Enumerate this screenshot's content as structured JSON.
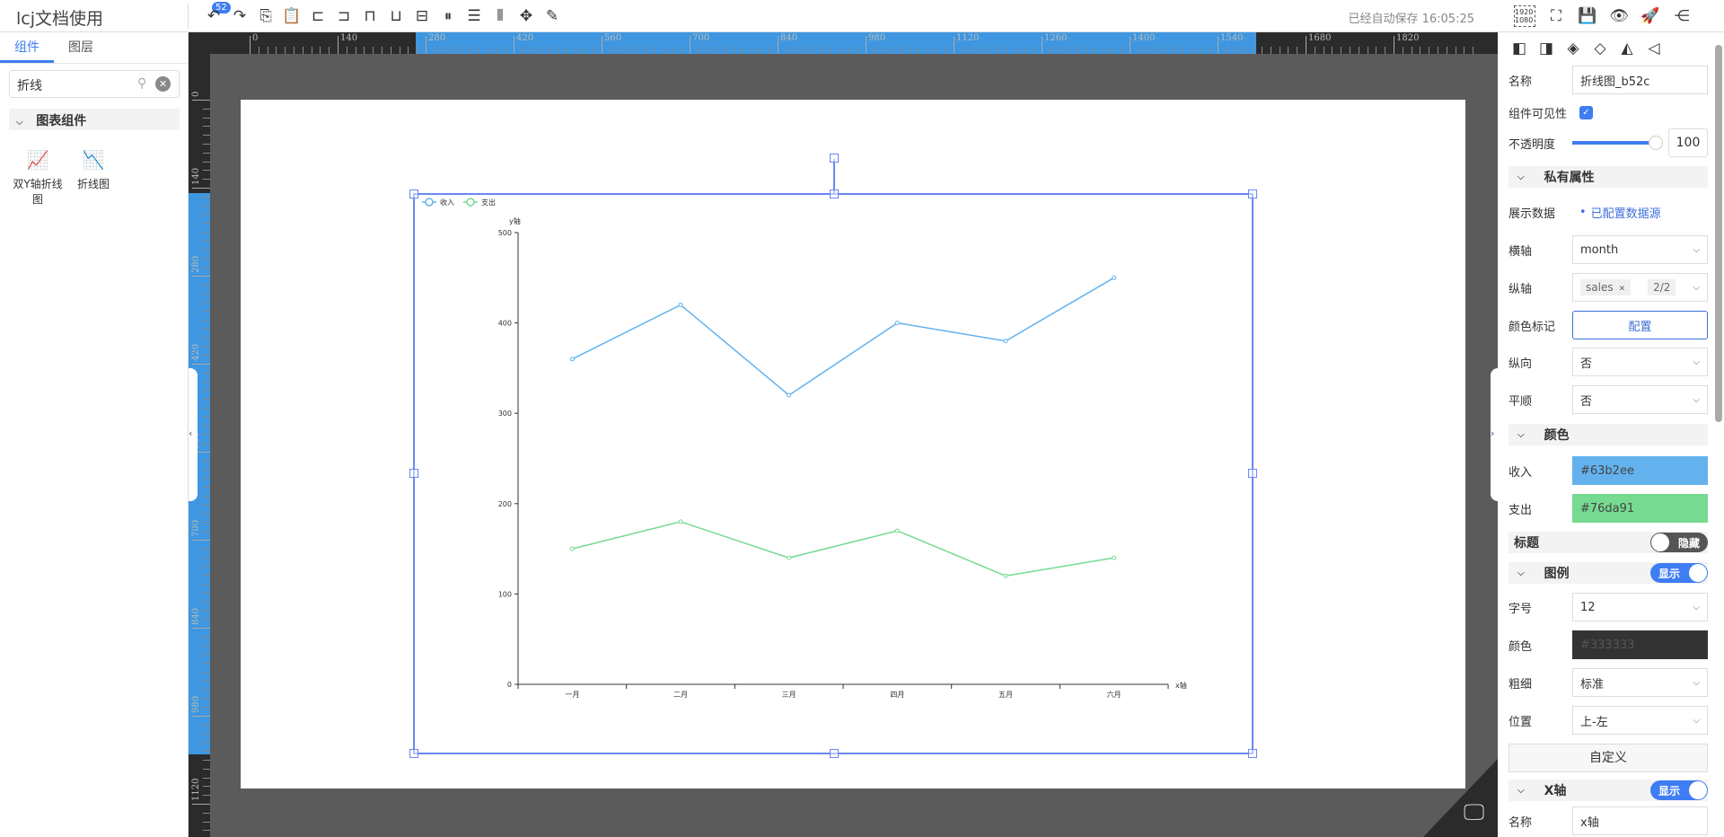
{
  "header": {
    "title": "lcj文档使用",
    "undo_count": "52",
    "autosave": "已经自动保存 16:05:25",
    "toolbar": [
      "undo-icon",
      "redo-icon",
      "copy-icon",
      "paste-icon",
      "align-left-icon",
      "align-right-icon",
      "align-top-icon",
      "align-bottom-icon",
      "align-vcenter-icon",
      "align-hcenter-icon",
      "distribute-v-icon",
      "distribute-h-icon",
      "move-icon",
      "edit-icon"
    ],
    "right_tools": [
      "resolution-1920-1080-icon",
      "fit-screen-icon",
      "save-icon",
      "preview-icon",
      "publish-icon",
      "share-icon"
    ],
    "resolution_label": "1920 1080"
  },
  "left": {
    "tabs": [
      "组件",
      "图层"
    ],
    "search_value": "折线",
    "category": "图表组件",
    "components": [
      {
        "label": "双Y轴折线图",
        "icon": "dual-axis-line-chart-icon"
      },
      {
        "label": "折线图",
        "icon": "line-chart-icon"
      }
    ]
  },
  "rulers": {
    "top": [
      "0",
      "140",
      "280",
      "420",
      "560",
      "700",
      "840",
      "980",
      "1120",
      "1260",
      "1400",
      "1540",
      "1680",
      "1820"
    ],
    "left": [
      "0",
      "140",
      "280",
      "420",
      "560",
      "700",
      "840",
      "980",
      "1120"
    ]
  },
  "chart_data": {
    "type": "line",
    "categories": [
      "一月",
      "二月",
      "三月",
      "四月",
      "五月",
      "六月"
    ],
    "series": [
      {
        "name": "收入",
        "values": [
          360,
          420,
          320,
          400,
          380,
          450
        ],
        "color": "#63b2ee"
      },
      {
        "name": "支出",
        "values": [
          150,
          180,
          140,
          170,
          120,
          140
        ],
        "color": "#76da91"
      }
    ],
    "xlabel": "x轴",
    "ylabel": "y轴",
    "ylim": [
      0,
      500
    ],
    "yticks": [
      "0",
      "100",
      "200",
      "300",
      "400",
      "500"
    ],
    "legend": "top-left",
    "grid": false
  },
  "props": {
    "tools": [
      "bring-front-icon",
      "send-back-icon",
      "layer-up-icon",
      "layer-down-icon",
      "flip-h-icon",
      "flip-v-icon"
    ],
    "name_label": "名称",
    "name_value": "折线图_b52c",
    "visible_label": "组件可见性",
    "opacity_label": "不透明度",
    "opacity_value": "100",
    "opacity": 100,
    "private_section": "私有属性",
    "data_label": "展示数据",
    "data_value": "已配置数据源",
    "xaxis_label": "横轴",
    "xaxis_value": "month",
    "yaxis_label": "纵轴",
    "yaxis_tag": "sales",
    "yaxis_count": "2/2",
    "color_mark_label": "颜色标记",
    "color_mark_button": "配置",
    "vertical_label": "纵向",
    "vertical_value": "否",
    "smooth_label": "平顺",
    "smooth_value": "否",
    "color_section": "颜色",
    "income_label": "收入",
    "income_color": "#63b2ee",
    "expense_label": "支出",
    "expense_color": "#76da91",
    "title_label": "标题",
    "title_toggle": "隐藏",
    "legend_section": "图例",
    "legend_toggle": "显示",
    "fontsize_label": "字号",
    "fontsize_value": "12",
    "legend_color_label": "颜色",
    "legend_color": "#333333",
    "weight_label": "粗细",
    "weight_value": "标准",
    "position_label": "位置",
    "position_value": "上-左",
    "custom_button": "自定义",
    "xaxis_section": "X轴",
    "xaxis_toggle": "显示",
    "xaxis_name_label": "名称",
    "xaxis_name_value": "x轴"
  }
}
